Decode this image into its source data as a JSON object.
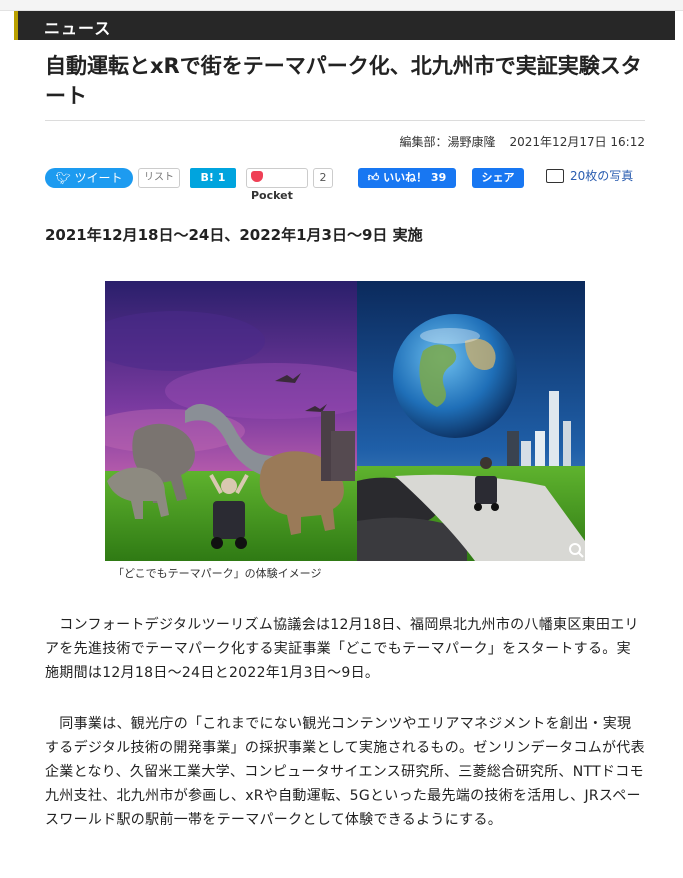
{
  "section": {
    "label": "ニュース"
  },
  "article": {
    "headline": "自動運転とxRで街をテーマパーク化、北九州市で実証実験スタート",
    "byline": {
      "editor": "編集部：湯野康隆",
      "date": "2021年12月17日 16:12"
    },
    "subheading": "2021年12月18日〜24日、2022年1月3日〜9日 実施",
    "image_caption": "「どこでもテーマパーク」の体験イメージ",
    "paragraphs": [
      "コンフォートデジタルツーリズム協議会は12月18日、福岡県北九州市の八幡東区東田エリアを先進技術でテーマパーク化する実証事業「どこでもテーマパーク」をスタートする。実施期間は12月18日〜24日と2022年1月3日〜9日。",
      "同事業は、観光庁の「これまでにない観光コンテンツやエリアマネジメントを創出・実現するデジタル技術の開発事業」の採択事業として実施されるもの。ゼンリンデータコムが代表企業となり、久留米工業大学、コンピュータサイエンス研究所、三菱総合研究所、NTTドコモ九州支社、北九州市が参画し、xRや自動運転、5Gといった最先端の技術を活用し、JRスペースワールド駅の駅前一帯をテーマパークとして体験できるようにする。"
    ]
  },
  "share": {
    "tweet_label": "ツイート",
    "list_label": "リスト",
    "hatena_label": "B! 1",
    "pocket_label": "Pocket",
    "pocket_count": "2",
    "facebook_label": "いいね！ 39",
    "share_label": "シェア",
    "photos_label": "20枚の写真"
  },
  "colors": {
    "section_bar": "#272727",
    "twitter": "#1d9bf0",
    "hatena": "#00a4de",
    "facebook": "#1877f2",
    "pocket": "#ef4056"
  }
}
